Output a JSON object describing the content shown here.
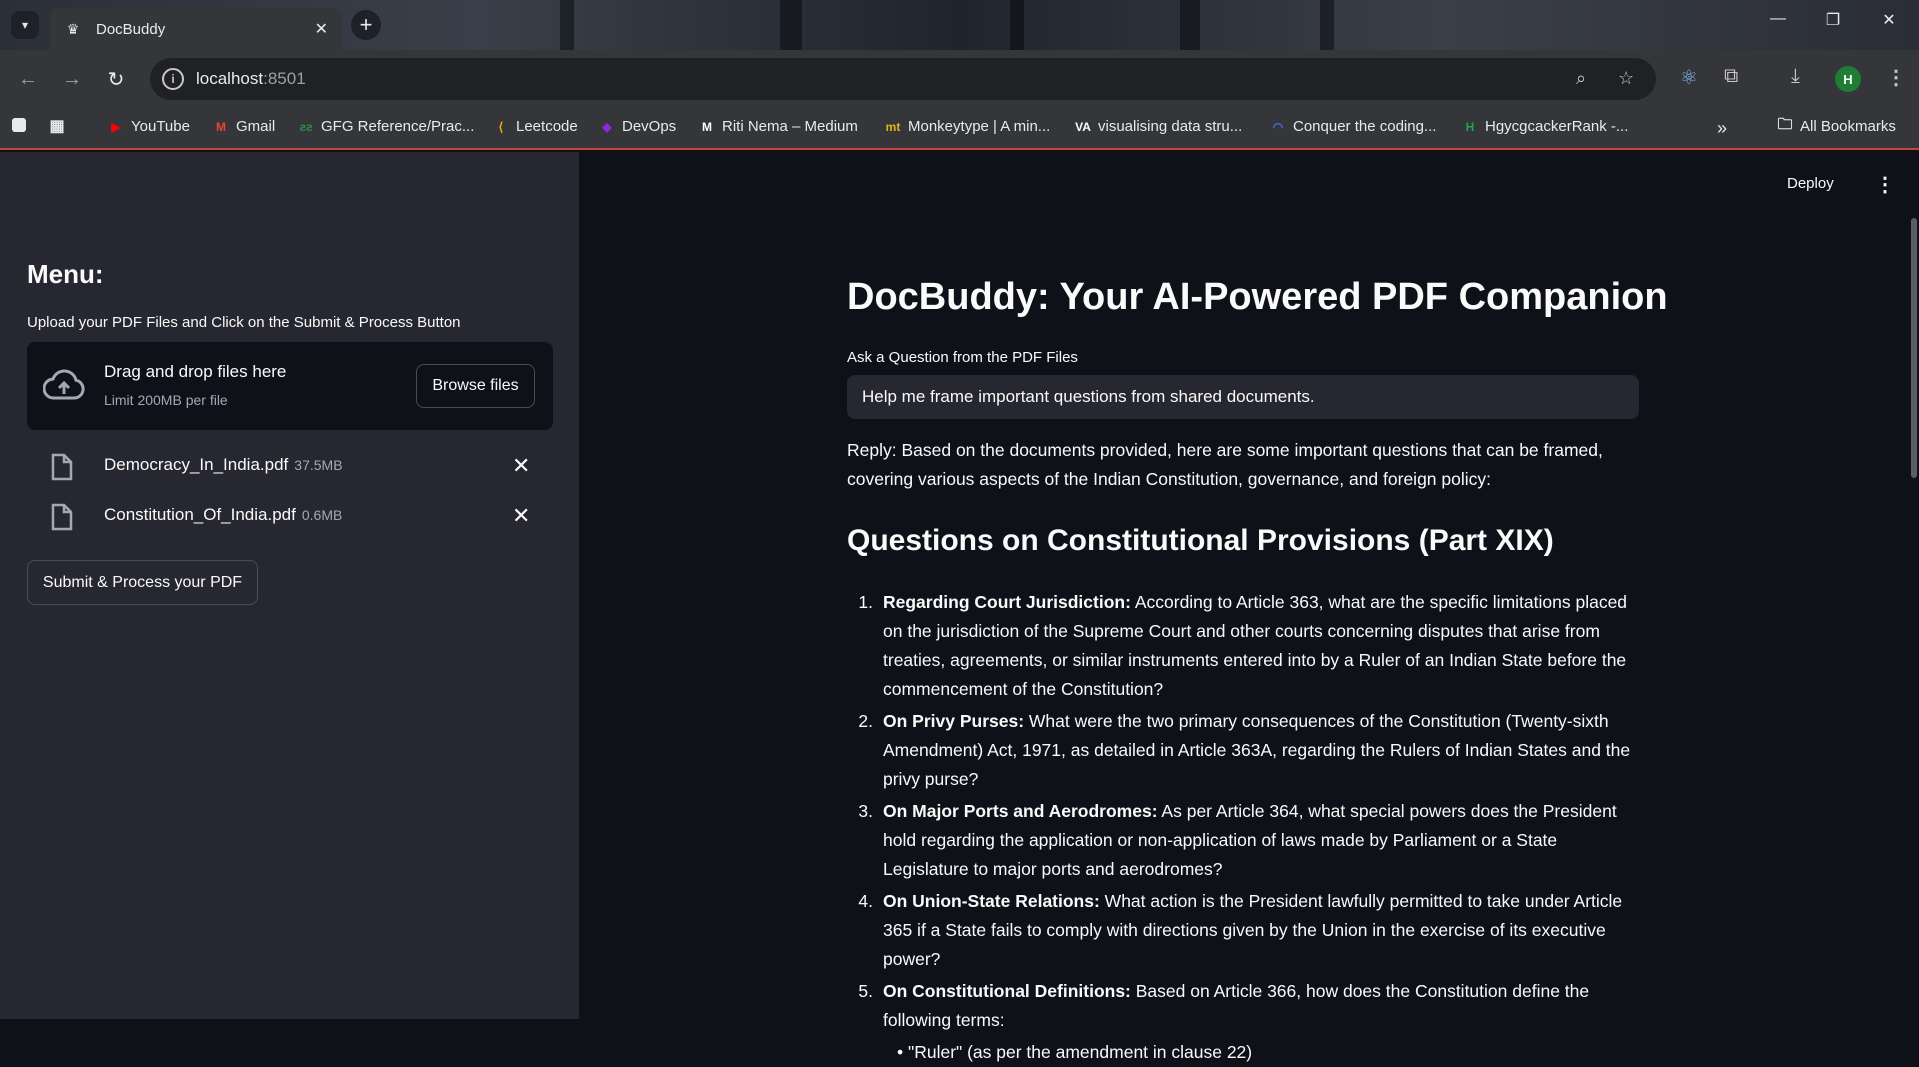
{
  "browser": {
    "tab_title": "DocBuddy",
    "url_host": "localhost",
    "url_port": ":8501",
    "bookmarks": [
      {
        "label": "YouTube",
        "icon": "youtube-icon",
        "color": "#ff0000"
      },
      {
        "label": "Gmail",
        "icon": "gmail-icon",
        "color": "#ea4335"
      },
      {
        "label": "GFG Reference/Prac...",
        "icon": "gfg-icon",
        "color": "#2f8d46"
      },
      {
        "label": "Leetcode",
        "icon": "leetcode-icon",
        "color": "#ffa116"
      },
      {
        "label": "DevOps",
        "icon": "devops-icon",
        "color": "#8a2be2"
      },
      {
        "label": "Riti Nema – Medium",
        "icon": "medium-icon",
        "color": "#ffffff"
      },
      {
        "label": "Monkeytype | A min...",
        "icon": "monkeytype-icon",
        "color": "#e2b714"
      },
      {
        "label": "visualising data stru...",
        "icon": "visualgo-icon",
        "color": "#ffffff"
      },
      {
        "label": "Conquer the coding...",
        "icon": "coding-icon",
        "color": "#4b6bfb"
      },
      {
        "label": "HgycgcackerRank -...",
        "icon": "hackerrank-icon",
        "color": "#1ba94c"
      }
    ],
    "all_bookmarks": "All Bookmarks",
    "profile_initial": "H"
  },
  "sidebar": {
    "menu_title": "Menu:",
    "upload_label": "Upload your PDF Files and Click on the Submit & Process Button",
    "dropzone_main": "Drag and drop files here",
    "dropzone_limit": "Limit 200MB per file",
    "browse_label": "Browse files",
    "files": [
      {
        "name": "Democracy_In_India.pdf",
        "size": "37.5MB"
      },
      {
        "name": "Constitution_Of_India.pdf",
        "size": "0.6MB"
      }
    ],
    "submit_label": "Submit & Process your PDF"
  },
  "header": {
    "deploy_label": "Deploy"
  },
  "main": {
    "title": "DocBuddy: Your AI-Powered PDF Companion",
    "question_label": "Ask a Question from the PDF Files",
    "question_value": "Help me frame important questions from shared documents.",
    "reply": "Reply: Based on the documents provided, here are some important questions that can be framed, covering various aspects of the Indian Constitution, governance, and foreign policy:",
    "section_heading": "Questions on Constitutional Provisions (Part XIX)",
    "questions": [
      {
        "num": "1.",
        "bold": "Regarding Court Jurisdiction:",
        "text": " According to Article 363, what are the specific limitations placed on the jurisdiction of the Supreme Court and other courts concerning disputes that arise from treaties, agreements, or similar instruments entered into by a Ruler of an Indian State before the commencement of the Constitution?"
      },
      {
        "num": "2.",
        "bold": "On Privy Purses:",
        "text": " What were the two primary consequences of the Constitution (Twenty-sixth Amendment) Act, 1971, as detailed in Article 363A, regarding the Rulers of Indian States and the privy purse?"
      },
      {
        "num": "3.",
        "bold": "On Major Ports and Aerodromes:",
        "text": " As per Article 364, what special powers does the President hold regarding the application or non-application of laws made by Parliament or a State Legislature to major ports and aerodromes?"
      },
      {
        "num": "4.",
        "bold": "On Union-State Relations:",
        "text": " What action is the President lawfully permitted to take under Article 365 if a State fails to comply with directions given by the Union in the exercise of its executive power?"
      },
      {
        "num": "5.",
        "bold": "On Constitutional Definitions:",
        "text": " Based on Article 366, how does the Constitution define the following terms:"
      }
    ],
    "sub_item_partial": "\"Ruler\" (as per the amendment in clause 22)"
  }
}
